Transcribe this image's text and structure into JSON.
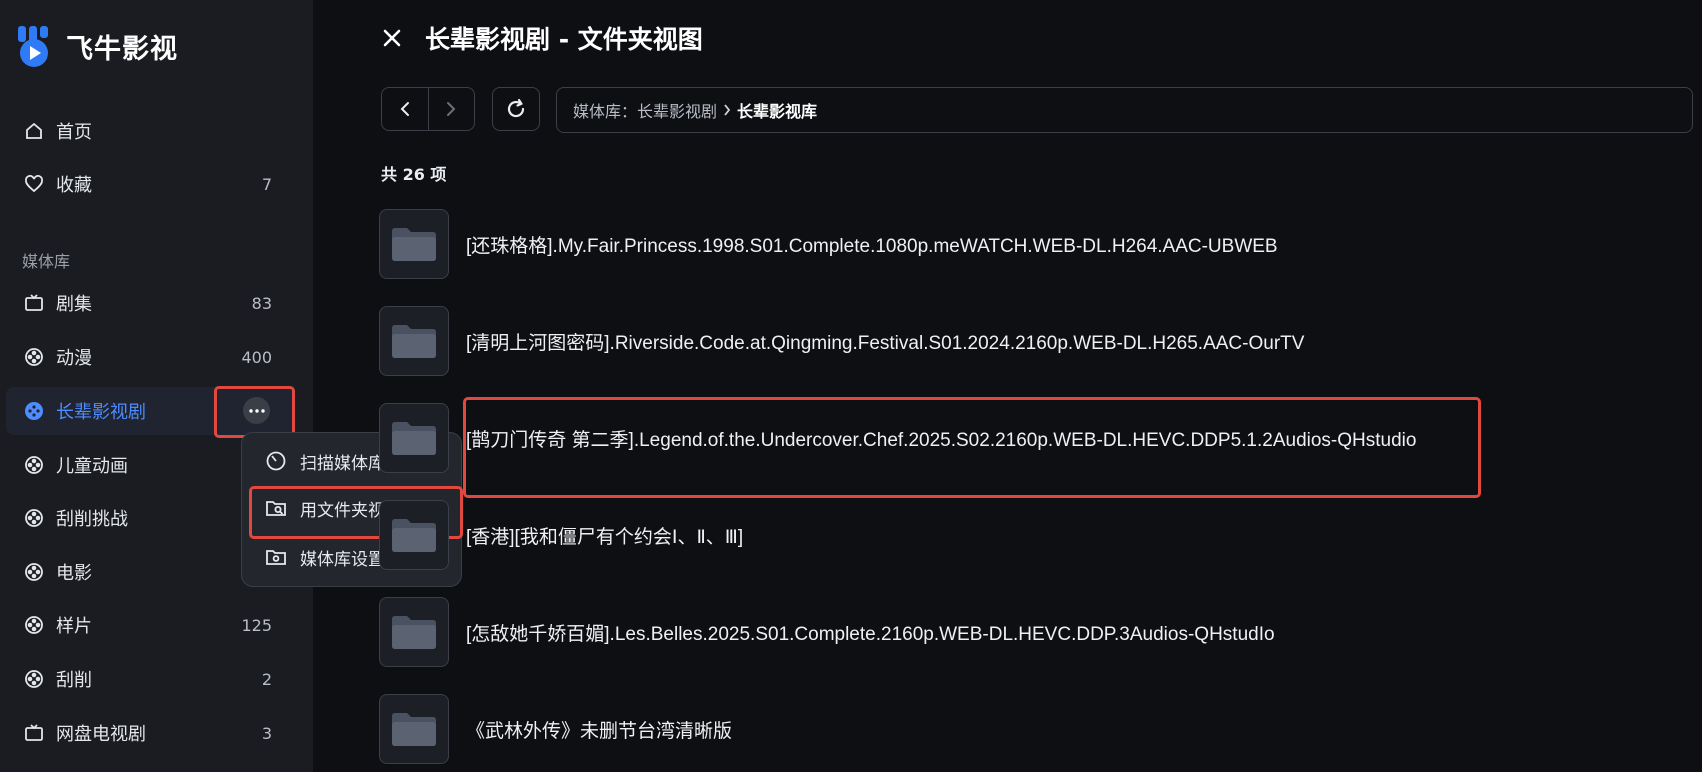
{
  "app": {
    "name": "飞牛影视"
  },
  "sidebar": {
    "nav": [
      {
        "label": "首页",
        "icon": "home-icon",
        "count": ""
      },
      {
        "label": "收藏",
        "icon": "heart-icon",
        "count": "7"
      }
    ],
    "section_title": "媒体库",
    "libraries": [
      {
        "label": "剧集",
        "icon": "tv-icon",
        "count": "83"
      },
      {
        "label": "动漫",
        "icon": "film-reel-icon",
        "count": "400"
      },
      {
        "label": "长辈影视剧",
        "icon": "film-reel-icon",
        "count": "",
        "active": true
      },
      {
        "label": "儿童动画",
        "icon": "film-reel-icon",
        "count": ""
      },
      {
        "label": "刮削挑战",
        "icon": "film-reel-icon",
        "count": ""
      },
      {
        "label": "电影",
        "icon": "film-reel-icon",
        "count": ""
      },
      {
        "label": "样片",
        "icon": "film-reel-icon",
        "count": "125"
      },
      {
        "label": "刮削",
        "icon": "film-reel-icon",
        "count": "2"
      },
      {
        "label": "网盘电视剧",
        "icon": "tv-icon",
        "count": "3"
      }
    ],
    "context_menu": [
      {
        "label": "扫描媒体库文件",
        "icon": "scan-icon"
      },
      {
        "label": "用文件夹视图查看",
        "icon": "folder-search-icon"
      },
      {
        "label": "媒体库设置",
        "icon": "folder-settings-icon"
      }
    ]
  },
  "main": {
    "title": "长辈影视剧 - 文件夹视图",
    "breadcrumb": {
      "root": "媒体库：长辈影视剧",
      "current": "长辈影视库"
    },
    "count_label": "共 26 项",
    "folders": [
      {
        "name": "[还珠格格].My.Fair.Princess.1998.S01.Complete.1080p.meWATCH.WEB-DL.H264.AAC-UBWEB"
      },
      {
        "name": "[清明上河图密码].Riverside.Code.at.Qingming.Festival.S01.2024.2160p.WEB-DL.H265.AAC-OurTV"
      },
      {
        "name": "[鹊刀门传奇 第二季].Legend.of.the.Undercover.Chef.2025.S02.2160p.WEB-DL.HEVC.DDP5.1.2Audios-QHstudio"
      },
      {
        "name": "[香港][我和僵尸有个约会Ⅰ、Ⅱ、Ⅲ]"
      },
      {
        "name": "[怎敌她千娇百媚].Les.Belles.2025.S01.Complete.2160p.WEB-DL.HEVC.DDP.3Audios-QHstudIo"
      },
      {
        "name": "《武林外传》未删节台湾清晰版"
      }
    ]
  },
  "colors": {
    "accent": "#4e8cff",
    "highlight": "#e2493e",
    "sidebar_bg": "#1a1c21",
    "main_bg": "#0d0f12"
  }
}
